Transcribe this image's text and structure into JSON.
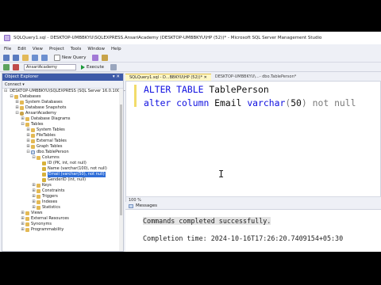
{
  "window": {
    "title": "SQLQuery1.sql - DESKTOP-UMBBKYU\\SQLEXPRESS.AnsariAcademy (DESKTOP-UMBBKYU\\HP (52))* - Microsoft SQL Server Management Studio"
  },
  "menu": [
    "File",
    "Edit",
    "View",
    "Project",
    "Tools",
    "Window",
    "Help"
  ],
  "toolbar": {
    "new_query": "New Query",
    "database": "AnsariAcademy",
    "execute": "Execute"
  },
  "object_explorer": {
    "title": "Object Explorer",
    "pin": "▾ ✕",
    "connect": "Connect ▾",
    "nodes": [
      {
        "label": "DESKTOP-UMBBKYU\\SQLEXPRESS (SQL Server 16.0.1000 - DESKTOP-UMBBKYU\\HP)",
        "exp": "⊟",
        "icon": "server"
      },
      {
        "label": "Databases",
        "exp": "⊟",
        "icon": "folder"
      },
      {
        "label": "System Databases",
        "exp": "⊞",
        "icon": "folder"
      },
      {
        "label": "Database Snapshots",
        "exp": "⊞",
        "icon": "folder"
      },
      {
        "label": "AnsariAcademy",
        "exp": "⊟",
        "icon": "db"
      },
      {
        "label": "Database Diagrams",
        "exp": "⊞",
        "icon": "folder"
      },
      {
        "label": "Tables",
        "exp": "⊟",
        "icon": "folder"
      },
      {
        "label": "System Tables",
        "exp": "⊞",
        "icon": "folder"
      },
      {
        "label": "FileTables",
        "exp": "⊞",
        "icon": "folder"
      },
      {
        "label": "External Tables",
        "exp": "⊞",
        "icon": "folder"
      },
      {
        "label": "Graph Tables",
        "exp": "⊞",
        "icon": "folder"
      },
      {
        "label": "dbo.TablePerson",
        "exp": "⊟",
        "icon": "table"
      },
      {
        "label": "Columns",
        "exp": "⊟",
        "icon": "folder"
      },
      {
        "label": "ID (PK, int, not null)",
        "exp": "",
        "icon": "col"
      },
      {
        "label": "Name (varchar(100), not null)",
        "exp": "",
        "icon": "col"
      },
      {
        "label": "Email (varchar(50), not null)",
        "exp": "",
        "icon": "col",
        "selected": true
      },
      {
        "label": "GenderID (int, null)",
        "exp": "",
        "icon": "col"
      },
      {
        "label": "Keys",
        "exp": "⊞",
        "icon": "folder"
      },
      {
        "label": "Constraints",
        "exp": "⊞",
        "icon": "folder"
      },
      {
        "label": "Triggers",
        "exp": "⊞",
        "icon": "folder"
      },
      {
        "label": "Indexes",
        "exp": "⊞",
        "icon": "folder"
      },
      {
        "label": "Statistics",
        "exp": "⊞",
        "icon": "folder"
      },
      {
        "label": "Views",
        "exp": "⊞",
        "icon": "folder"
      },
      {
        "label": "External Resources",
        "exp": "⊞",
        "icon": "folder"
      },
      {
        "label": "Synonyms",
        "exp": "⊞",
        "icon": "folder"
      },
      {
        "label": "Programmability",
        "exp": "⊞",
        "icon": "folder"
      }
    ]
  },
  "tabs": [
    {
      "label": "SQLQuery1.sql - D...BBKYU\\HP (52))*  ✕",
      "active": true
    },
    {
      "label": "DESKTOP-UMBBKYU\\...- dbo.TablePerson*",
      "active": false
    }
  ],
  "editor": {
    "line1": {
      "kw1": "ALTER",
      "kw2": "TABLE",
      "ident": "TablePerson"
    },
    "line2": {
      "kw1": "alter",
      "kw2": "column",
      "ident": "Email",
      "type": "varchar",
      "open": "(",
      "num": "50",
      "close": ")",
      "tail": "not null"
    },
    "zoom": "100 %"
  },
  "results": {
    "tab": "Messages",
    "message": "Commands completed successfully.",
    "completion": "Completion time: 2024-10-16T17:26:20.7409154+05:30"
  },
  "colors": {
    "keyword": "#1010e0",
    "function": "#d41ad4",
    "selection": "#2f6ed8",
    "header": "#3d5aa8"
  }
}
